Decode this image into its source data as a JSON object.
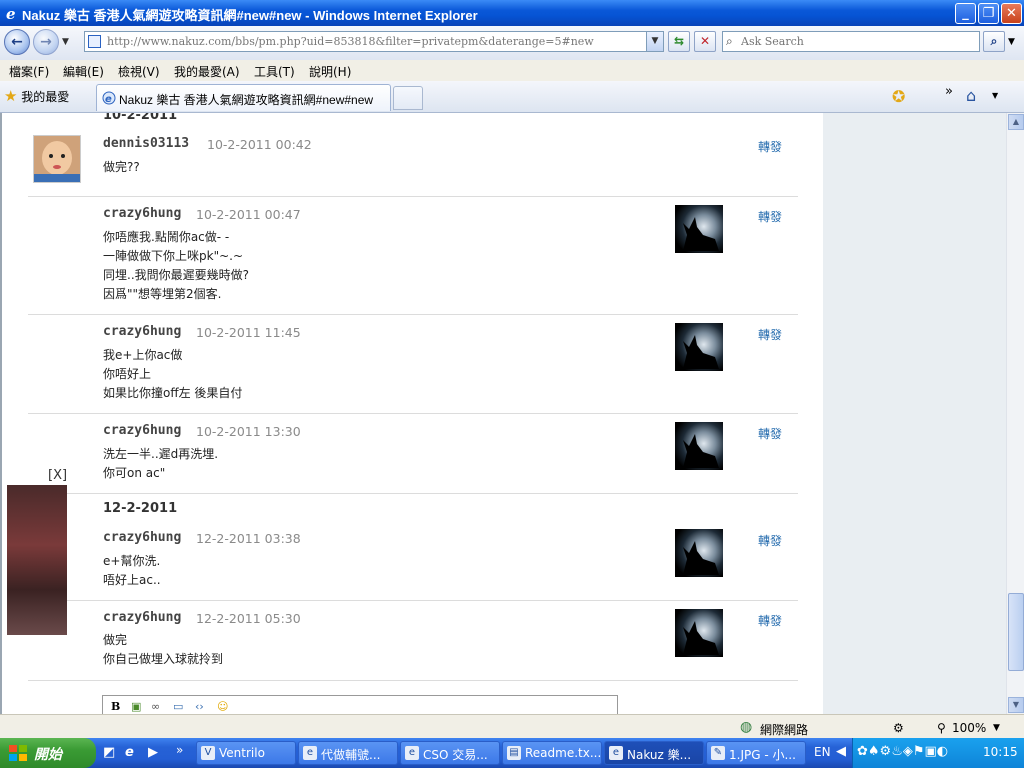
{
  "window": {
    "title": "Nakuz 樂古 香港人氣網遊攻略資訊網#new#new - Windows Internet Explorer"
  },
  "address": {
    "url": "http://www.nakuz.com/bbs/pm.php?uid=853818&filter=privatepm&daterange=5#new"
  },
  "search": {
    "placeholder": "Ask Search"
  },
  "menu": {
    "items": [
      "檔案(F)",
      "編輯(E)",
      "檢視(V)",
      "我的最愛(A)",
      "工具(T)",
      "說明(H)"
    ]
  },
  "favorites": {
    "label": "我的最愛"
  },
  "tab": {
    "label": "Nakuz 樂古 香港人氣網遊攻略資訊網#new#new"
  },
  "content": {
    "date_top": "10-2-2011",
    "date_mid": "12-2-2011",
    "forward_label": "轉發",
    "ad_close": "[X]",
    "messages": [
      {
        "user": "dennis03113",
        "time": "10-2-2011 00:42",
        "lines": [
          "做完??"
        ]
      },
      {
        "user": "crazy6hung",
        "time": "10-2-2011 00:47",
        "lines": [
          "你唔應我.點鬧你ac做- -",
          "一陣做做下你上咪pk\"~.~",
          "同埋..我問你最遲要幾時做?",
          "因爲\"\"想等埋第2個客."
        ]
      },
      {
        "user": "crazy6hung",
        "time": "10-2-2011 11:45",
        "lines": [
          "我e+上你ac做",
          "你唔好上",
          "如果比你撞off左 後果自付"
        ]
      },
      {
        "user": "crazy6hung",
        "time": "10-2-2011 13:30",
        "lines": [
          "洗左一半..遲d再洗埋.",
          "你可on ac\""
        ]
      },
      {
        "user": "crazy6hung",
        "time": "12-2-2011 03:38",
        "lines": [
          "e+幫你洗.",
          "唔好上ac.."
        ]
      },
      {
        "user": "crazy6hung",
        "time": "12-2-2011 05:30",
        "lines": [
          "做完",
          "你自己做埋入球就拎到"
        ]
      }
    ]
  },
  "status": {
    "zone": "網際網路",
    "zoom": "100%"
  },
  "taskbar": {
    "start": "開始",
    "tasks": [
      "Ventrilo",
      "代做輔號...",
      "CSO 交易...",
      "Readme.tx...",
      "Nakuz 樂...",
      "1.JPG - 小..."
    ],
    "lang": "EN",
    "clock": "10:15"
  }
}
